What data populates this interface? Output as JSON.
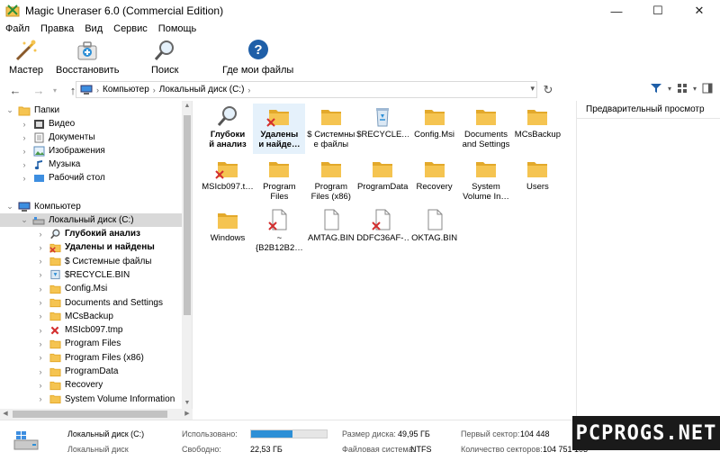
{
  "window": {
    "title": "Magic Uneraser 6.0 (Commercial Edition)",
    "minimize": "—",
    "maximize": "☐",
    "close": "✕"
  },
  "menu": [
    "Файл",
    "Правка",
    "Вид",
    "Сервис",
    "Помощь"
  ],
  "toolbar": {
    "wizard": "Мастер",
    "restore": "Восстановить",
    "search": "Поиск",
    "where": "Где мои файлы"
  },
  "address": {
    "root_icon": "computer-icon",
    "segments": [
      "Компьютер",
      "Локальный диск (C:)"
    ]
  },
  "tree": {
    "folders_label": "Папки",
    "folders": [
      "Видео",
      "Документы",
      "Изображения",
      "Музыка",
      "Рабочий стол"
    ],
    "computer_label": "Компьютер",
    "drive_label": "Локальный диск (C:)",
    "drive_items": [
      {
        "label": "Глубокий анализ",
        "bold": true,
        "icon": "deep-scan-icon"
      },
      {
        "label": "Удалены и найдены",
        "bold": true,
        "icon": "deleted-folder-icon"
      },
      {
        "label": "$ Системные файлы",
        "icon": "folder-icon"
      },
      {
        "label": "$RECYCLE.BIN",
        "icon": "recycle-bin-icon"
      },
      {
        "label": "Config.Msi",
        "icon": "folder-icon"
      },
      {
        "label": "Documents and Settings",
        "icon": "folder-icon"
      },
      {
        "label": "MCsBackup",
        "icon": "folder-icon"
      },
      {
        "label": "MSIcb097.tmp",
        "icon": "deleted-icon"
      },
      {
        "label": "Program Files",
        "icon": "folder-icon"
      },
      {
        "label": "Program Files (x86)",
        "icon": "folder-icon"
      },
      {
        "label": "ProgramData",
        "icon": "folder-icon"
      },
      {
        "label": "Recovery",
        "icon": "folder-icon"
      },
      {
        "label": "System Volume Information",
        "icon": "folder-icon"
      }
    ]
  },
  "files": [
    {
      "l1": "Глубоки",
      "l2": "й анализ",
      "kind": "scan",
      "bold": true
    },
    {
      "l1": "Удалены",
      "l2": "и найде…",
      "kind": "deleted-folder",
      "bold": true,
      "selected": true
    },
    {
      "l1": "$ Системны",
      "l2": "е файлы",
      "kind": "folder"
    },
    {
      "l1": "$RECYCLE.…",
      "l2": "",
      "kind": "recycle"
    },
    {
      "l1": "Config.Msi",
      "l2": "",
      "kind": "folder"
    },
    {
      "l1": "Documents",
      "l2": "and Settings",
      "kind": "folder"
    },
    {
      "l1": "MCsBackup",
      "l2": "",
      "kind": "folder"
    },
    {
      "l1": "MSIcb097.t…",
      "l2": "",
      "kind": "deleted-folder"
    },
    {
      "l1": "Program",
      "l2": "Files",
      "kind": "folder"
    },
    {
      "l1": "Program",
      "l2": "Files (x86)",
      "kind": "folder"
    },
    {
      "l1": "ProgramData",
      "l2": "",
      "kind": "folder"
    },
    {
      "l1": "Recovery",
      "l2": "",
      "kind": "folder"
    },
    {
      "l1": "System",
      "l2": "Volume In…",
      "kind": "folder"
    },
    {
      "l1": "Users",
      "l2": "",
      "kind": "folder"
    },
    {
      "l1": "Windows",
      "l2": "",
      "kind": "folder"
    },
    {
      "l1": "~{B2B12B2…",
      "l2": "",
      "kind": "deleted-file"
    },
    {
      "l1": "AMTAG.BIN",
      "l2": "",
      "kind": "file"
    },
    {
      "l1": "DDFC36AF-…",
      "l2": "",
      "kind": "deleted-file"
    },
    {
      "l1": "OKTAG.BIN",
      "l2": "",
      "kind": "file"
    }
  ],
  "preview": {
    "title": "Предварительный просмотр"
  },
  "status": {
    "drive_name": "Локальный диск (C:)",
    "drive_type": "Локальный диск",
    "used_label": "Использовано:",
    "used_fraction": 0.55,
    "free_label": "Свободно:",
    "free_value": "22,53 ГБ",
    "size_label": "Размер диска:",
    "size_value": "49,95 ГБ",
    "fs_label": "Файловая система:",
    "fs_value": "NTFS",
    "first_sector_label": "Первый сектор:",
    "first_sector_value": "104 448",
    "sectors_label": "Количество секторов:",
    "sectors_value": "104 751 103"
  },
  "watermark": "PCPROGS.NET",
  "colors": {
    "folder": "#f5c451",
    "folder_dark": "#e3a92b",
    "accent": "#2d8fd6",
    "delete_mark": "#d32f2f"
  }
}
